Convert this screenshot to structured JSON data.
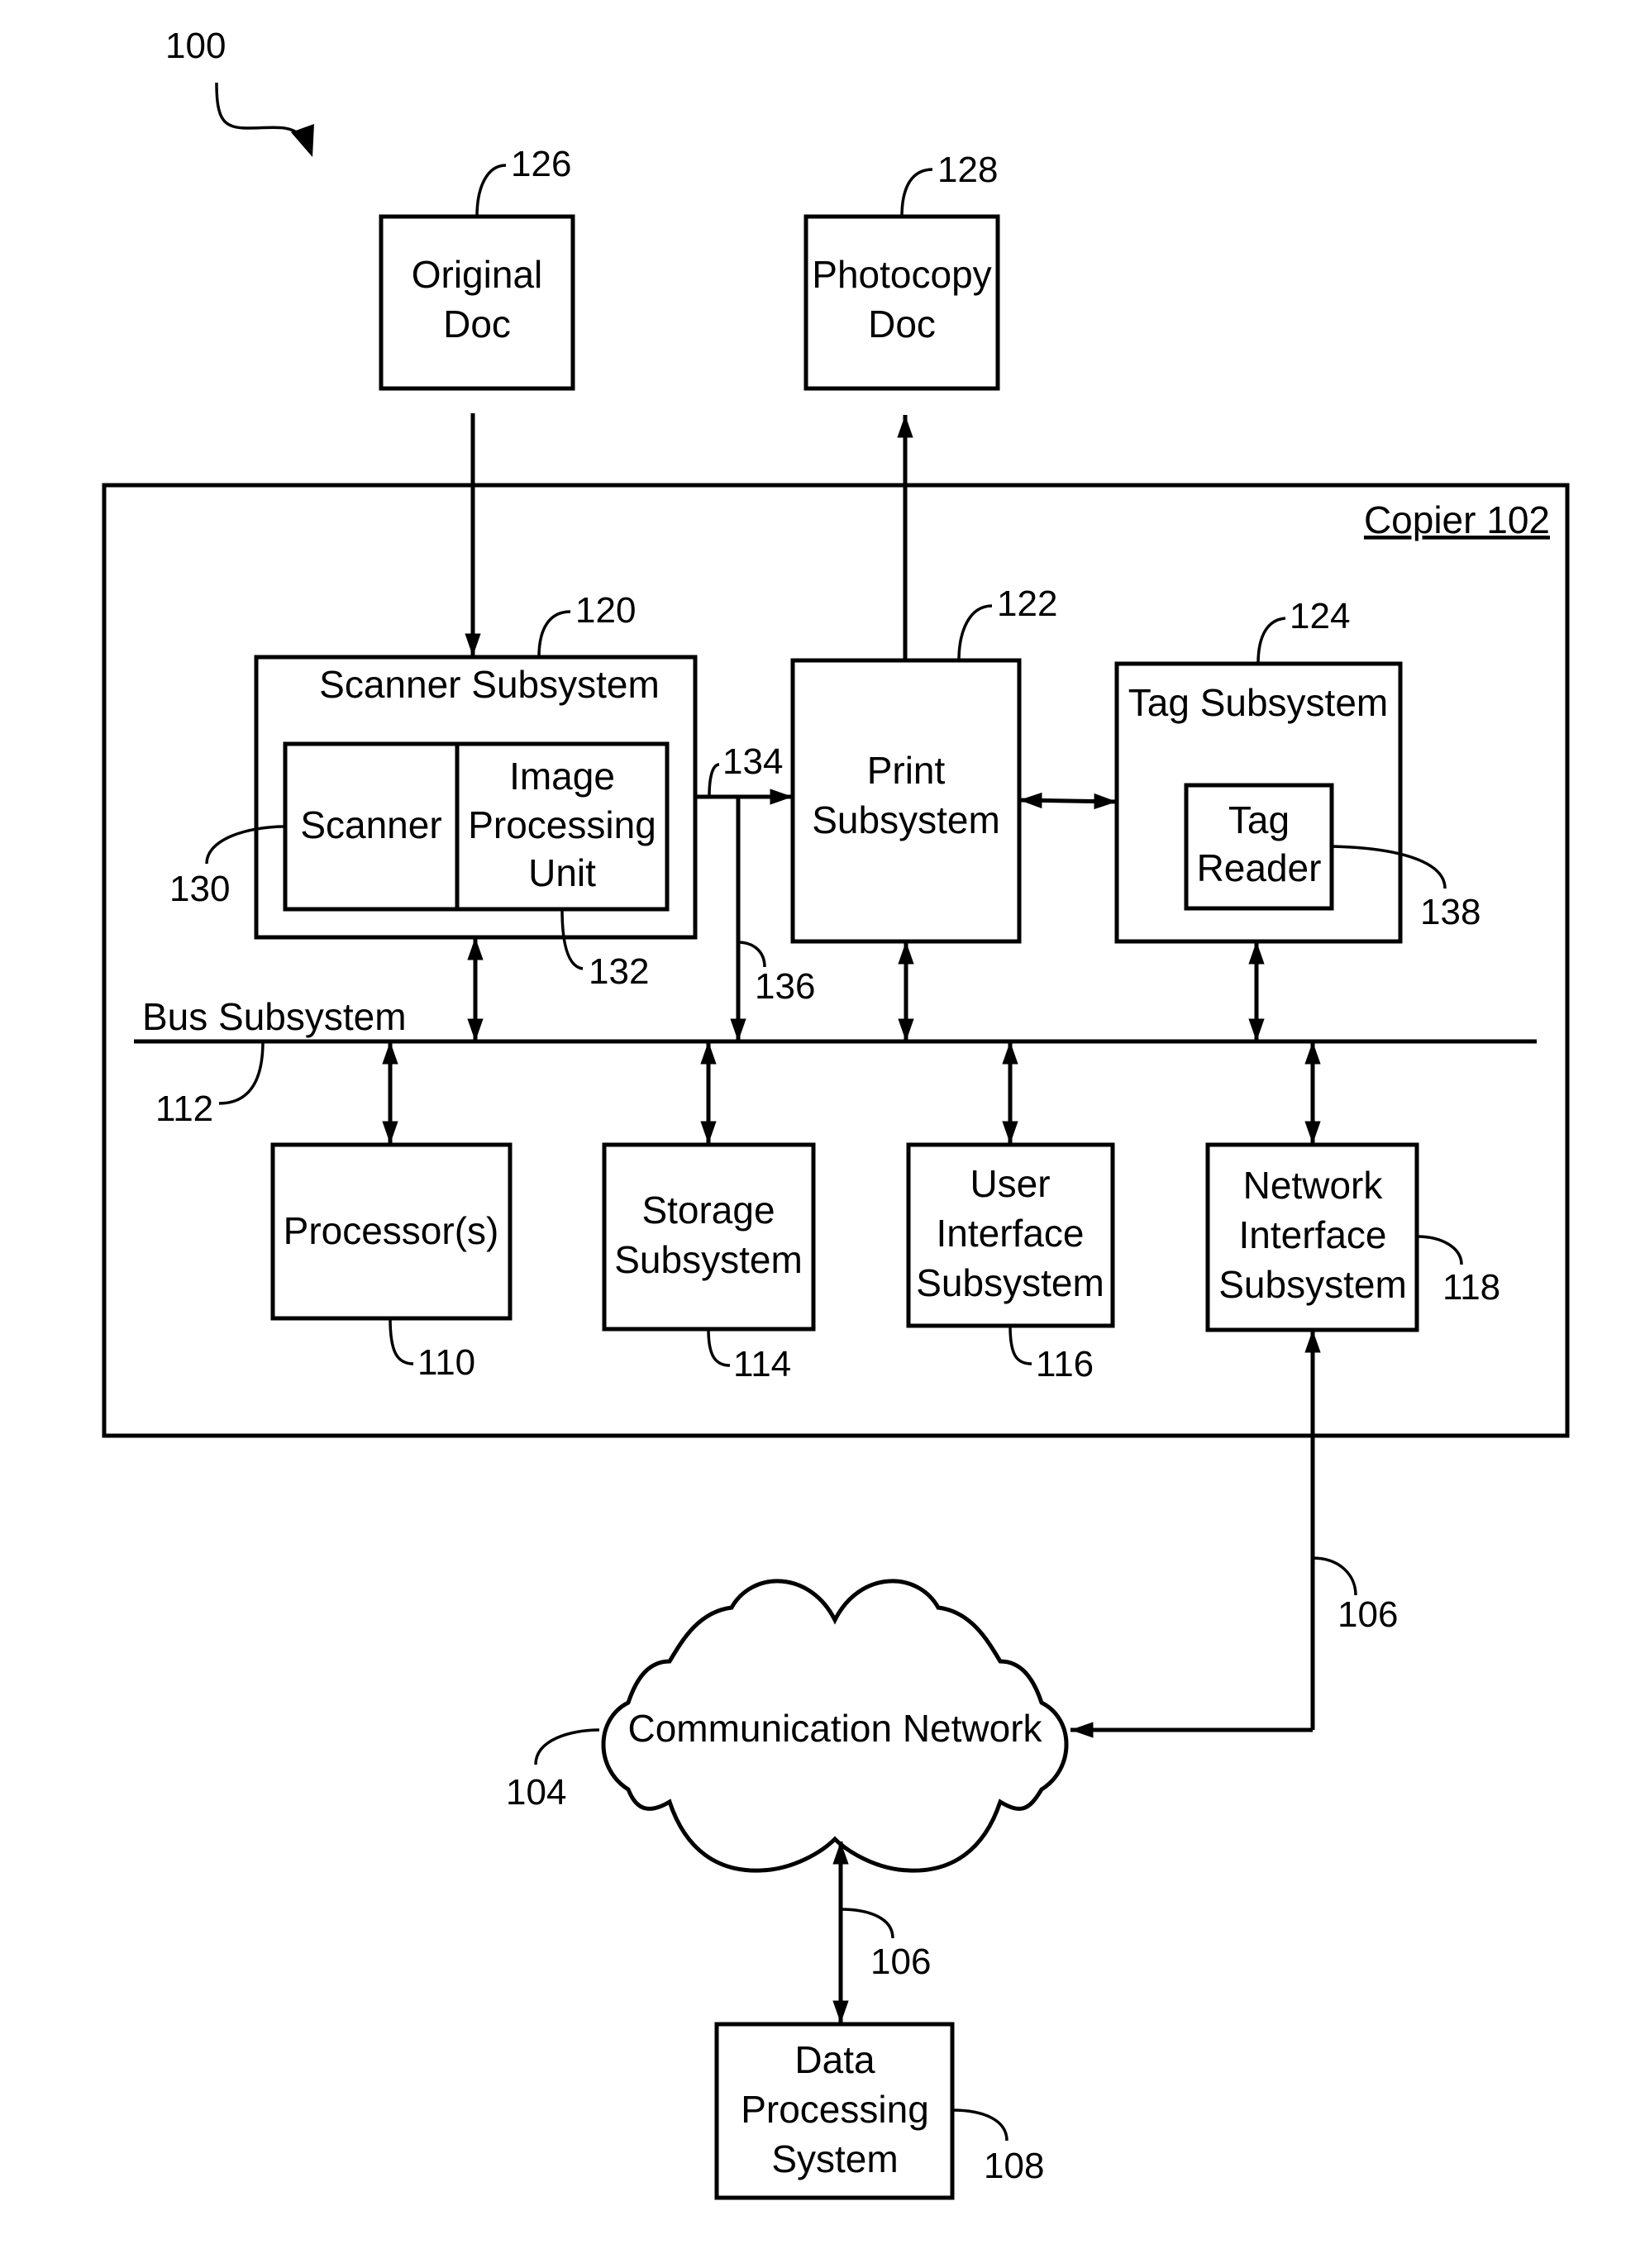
{
  "figure": {
    "ref": "100",
    "copier": {
      "label": "Copier 102"
    },
    "original_doc": {
      "lines": [
        "Original",
        "Doc"
      ],
      "ref": "126"
    },
    "photocopy_doc": {
      "lines": [
        "Photocopy",
        "Doc"
      ],
      "ref": "128"
    },
    "scanner_subsystem": {
      "label": "Scanner Subsystem",
      "ref": "120"
    },
    "scanner": {
      "label": "Scanner",
      "ref": "130"
    },
    "image_processing_unit": {
      "lines": [
        "Image",
        "Processing",
        "Unit"
      ],
      "ref": "132"
    },
    "print_subsystem": {
      "lines": [
        "Print",
        "Subsystem"
      ],
      "ref": "122"
    },
    "tag_subsystem": {
      "label": "Tag Subsystem",
      "ref": "124"
    },
    "tag_reader": {
      "lines": [
        "Tag",
        "Reader"
      ],
      "ref": "138"
    },
    "path_134": {
      "ref": "134"
    },
    "path_136": {
      "ref": "136"
    },
    "bus_subsystem": {
      "label": "Bus Subsystem",
      "ref": "112"
    },
    "processors": {
      "label": "Processor(s)",
      "ref": "110"
    },
    "storage_subsystem": {
      "lines": [
        "Storage",
        "Subsystem"
      ],
      "ref": "114"
    },
    "user_interface_subsystem": {
      "lines": [
        "User",
        "Interface",
        "Subsystem"
      ],
      "ref": "116"
    },
    "network_interface_subsystem": {
      "lines": [
        "Network",
        "Interface",
        "Subsystem"
      ],
      "ref": "118"
    },
    "communication_network": {
      "label": "Communication Network",
      "ref": "104"
    },
    "link_network_copier": {
      "ref": "106"
    },
    "link_network_dps": {
      "ref": "106"
    },
    "data_processing_system": {
      "lines": [
        "Data",
        "Processing",
        "System"
      ],
      "ref": "108"
    }
  }
}
